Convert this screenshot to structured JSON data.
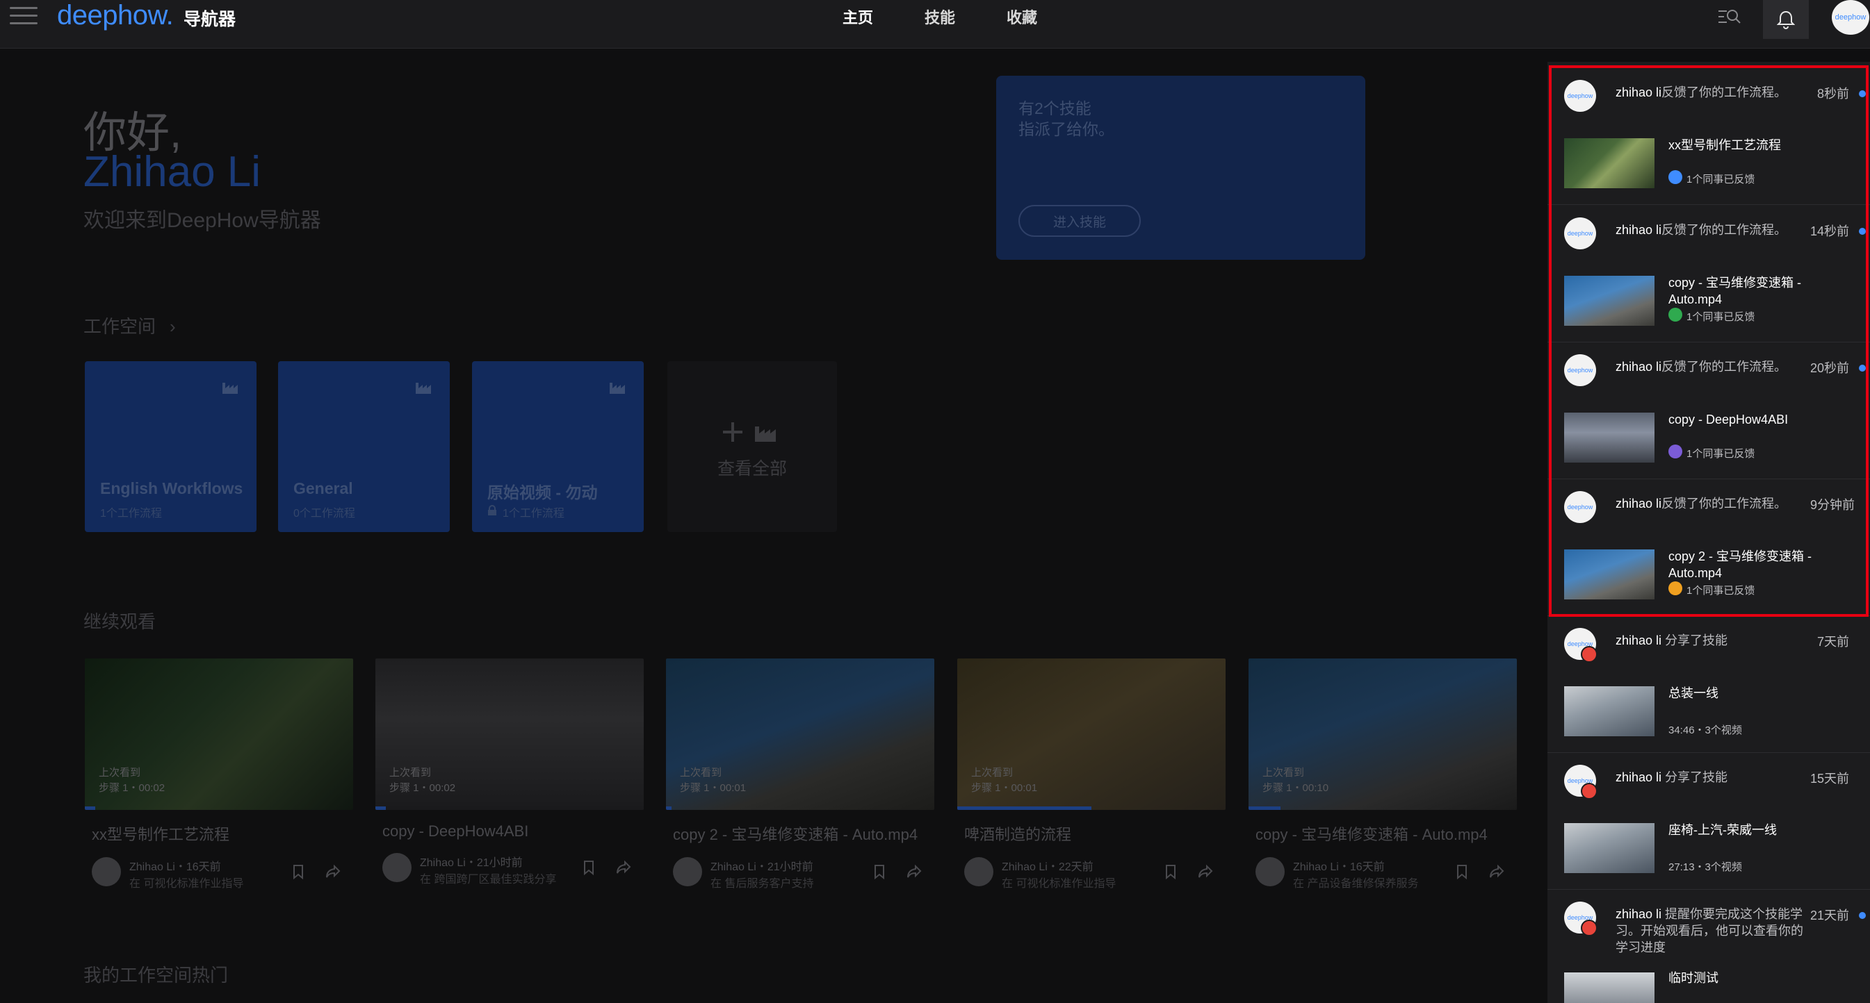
{
  "header": {
    "logo_text": "deephow",
    "logo_dot": ".",
    "logo_sub": "导航器",
    "nav": [
      "主页",
      "技能",
      "收藏"
    ],
    "avatar_text": "deephow"
  },
  "greeting": {
    "hello": "你好,",
    "name": "Zhihao Li",
    "welcome": "欢迎来到DeepHow导航器"
  },
  "skill_card": {
    "line1": "有2个技能",
    "line2": "指派了给你。",
    "button": "进入技能"
  },
  "workspaces": {
    "title": "工作空间",
    "items": [
      {
        "name": "English Workflows",
        "count": "1个工作流程"
      },
      {
        "name": "General",
        "count": "0个工作流程"
      },
      {
        "name": "原始视频 - 勿动",
        "count": "1个工作流程"
      }
    ],
    "view_all": "查看全部"
  },
  "continue": {
    "title": "继续观看",
    "videos": [
      {
        "overlay1": "上次看到",
        "overlay2": "步骤 1・00:02",
        "title": "xx型号制作工艺流程",
        "user": "Zhihao Li・16天前",
        "space": "在 可视化标准作业指导",
        "progress": 0.04
      },
      {
        "overlay1": "上次看到",
        "overlay2": "步骤 1・00:02",
        "title": "copy - DeepHow4ABI",
        "user": "Zhihao Li・21小时前",
        "space": "在 跨国跨厂区最佳实践分享",
        "progress": 0.04
      },
      {
        "overlay1": "上次看到",
        "overlay2": "步骤 1・00:01",
        "title": "copy 2 - 宝马维修变速箱 - Auto.mp4",
        "user": "Zhihao Li・21小时前",
        "space": "在 售后服务客户支持",
        "progress": 0.02
      },
      {
        "overlay1": "上次看到",
        "overlay2": "步骤 1・00:01",
        "title": "啤酒制造的流程",
        "user": "Zhihao Li・22天前",
        "space": "在 可视化标准作业指导",
        "progress": 0.5
      },
      {
        "overlay1": "上次看到",
        "overlay2": "步骤 1・00:10",
        "title": "copy - 宝马维修变速箱 - Auto.mp4",
        "user": "Zhihao Li・16天前",
        "space": "在 产品设备维修保养服务",
        "progress": 0.12
      }
    ]
  },
  "hot": {
    "title": "我的工作空间热门"
  },
  "notifications": [
    {
      "user": "zhihao li",
      "action": "反馈了你的工作流程。",
      "time": "8秒前",
      "title": "xx型号制作工艺流程",
      "sub": "1个同事已反馈",
      "icon_color": "#3f8cff",
      "unread": true
    },
    {
      "user": "zhihao li",
      "action": "反馈了你的工作流程。",
      "time": "14秒前",
      "title": "copy - 宝马维修变速箱 - Auto.mp4",
      "sub": "1个同事已反馈",
      "icon_color": "#2faa4f",
      "unread": true
    },
    {
      "user": "zhihao li",
      "action": "反馈了你的工作流程。",
      "time": "20秒前",
      "title": "copy - DeepHow4ABI",
      "sub": "1个同事已反馈",
      "icon_color": "#7b5cd6",
      "unread": true
    },
    {
      "user": "zhihao li",
      "action": "反馈了你的工作流程。",
      "time": "9分钟前",
      "title": "copy 2 - 宝马维修变速箱 - Auto.mp4",
      "sub": "1个同事已反馈",
      "icon_color": "#f0a020",
      "unread": false
    },
    {
      "user": "zhihao li",
      "action": " 分享了技能",
      "time": "7天前",
      "title": "总装一线",
      "sub": "34:46・3个视频",
      "unread": false
    },
    {
      "user": "zhihao li",
      "action": " 分享了技能",
      "time": "15天前",
      "title": "座椅-上汽-荣威一线",
      "sub": "27:13・3个视频",
      "unread": false
    },
    {
      "user": "zhihao li",
      "action": " 提醒你要完成这个技能学习。开始观看后，他可以查看你的学习进度",
      "time": "21天前",
      "title": "临时测试",
      "sub": "",
      "unread": true
    }
  ],
  "colors": {
    "accent": "#3f8cff",
    "highlight": "#e60012",
    "panel": "#1c1c1e"
  }
}
